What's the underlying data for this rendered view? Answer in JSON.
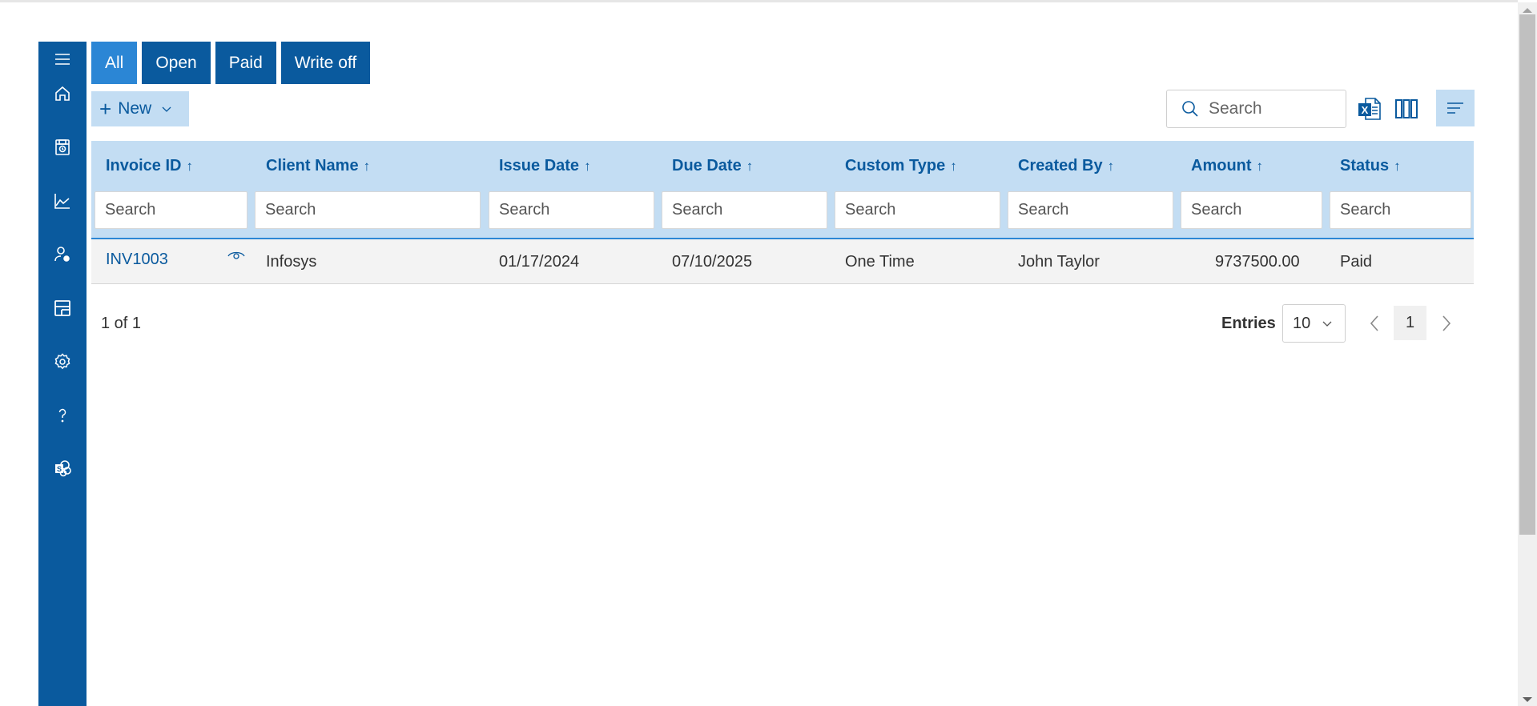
{
  "sidebar": {
    "items": [
      {
        "icon": "menu-icon"
      },
      {
        "icon": "home-icon"
      },
      {
        "icon": "invoice-icon"
      },
      {
        "icon": "chart-icon"
      },
      {
        "icon": "user-settings-icon"
      },
      {
        "icon": "form-icon"
      },
      {
        "icon": "gear-icon"
      },
      {
        "icon": "help-icon"
      },
      {
        "icon": "sharepoint-icon"
      }
    ]
  },
  "tabs": [
    {
      "label": "All",
      "active": true
    },
    {
      "label": "Open",
      "active": false
    },
    {
      "label": "Paid",
      "active": false
    },
    {
      "label": "Write off",
      "active": false
    }
  ],
  "toolbar": {
    "new_label": "New",
    "search_placeholder": "Search"
  },
  "grid": {
    "columns": [
      {
        "title": "Invoice ID",
        "sort": "↑",
        "filter_placeholder": "Search"
      },
      {
        "title": "Client Name",
        "sort": "↑",
        "filter_placeholder": "Search"
      },
      {
        "title": "Issue Date",
        "sort": "↑",
        "filter_placeholder": "Search"
      },
      {
        "title": "Due Date",
        "sort": "↑",
        "filter_placeholder": "Search"
      },
      {
        "title": "Custom Type",
        "sort": "↑",
        "filter_placeholder": "Search"
      },
      {
        "title": "Created By",
        "sort": "↑",
        "filter_placeholder": "Search"
      },
      {
        "title": "Amount",
        "sort": "↑",
        "filter_placeholder": "Search"
      },
      {
        "title": "Status",
        "sort": "↑",
        "filter_placeholder": "Search"
      }
    ],
    "rows": [
      {
        "invoice_id": "INV1003",
        "client_name": "Infosys",
        "issue_date": "01/17/2024",
        "due_date": "07/10/2025",
        "custom_type": "One Time",
        "created_by": "John Taylor",
        "amount": "9737500.00",
        "status": "Paid"
      }
    ]
  },
  "pager": {
    "summary": "1 of 1",
    "entries_label": "Entries",
    "entries_value": "10",
    "current_page": "1"
  },
  "colors": {
    "primary": "#0a5a9e",
    "accent": "#2b86d5",
    "light": "#c3ddf3"
  }
}
